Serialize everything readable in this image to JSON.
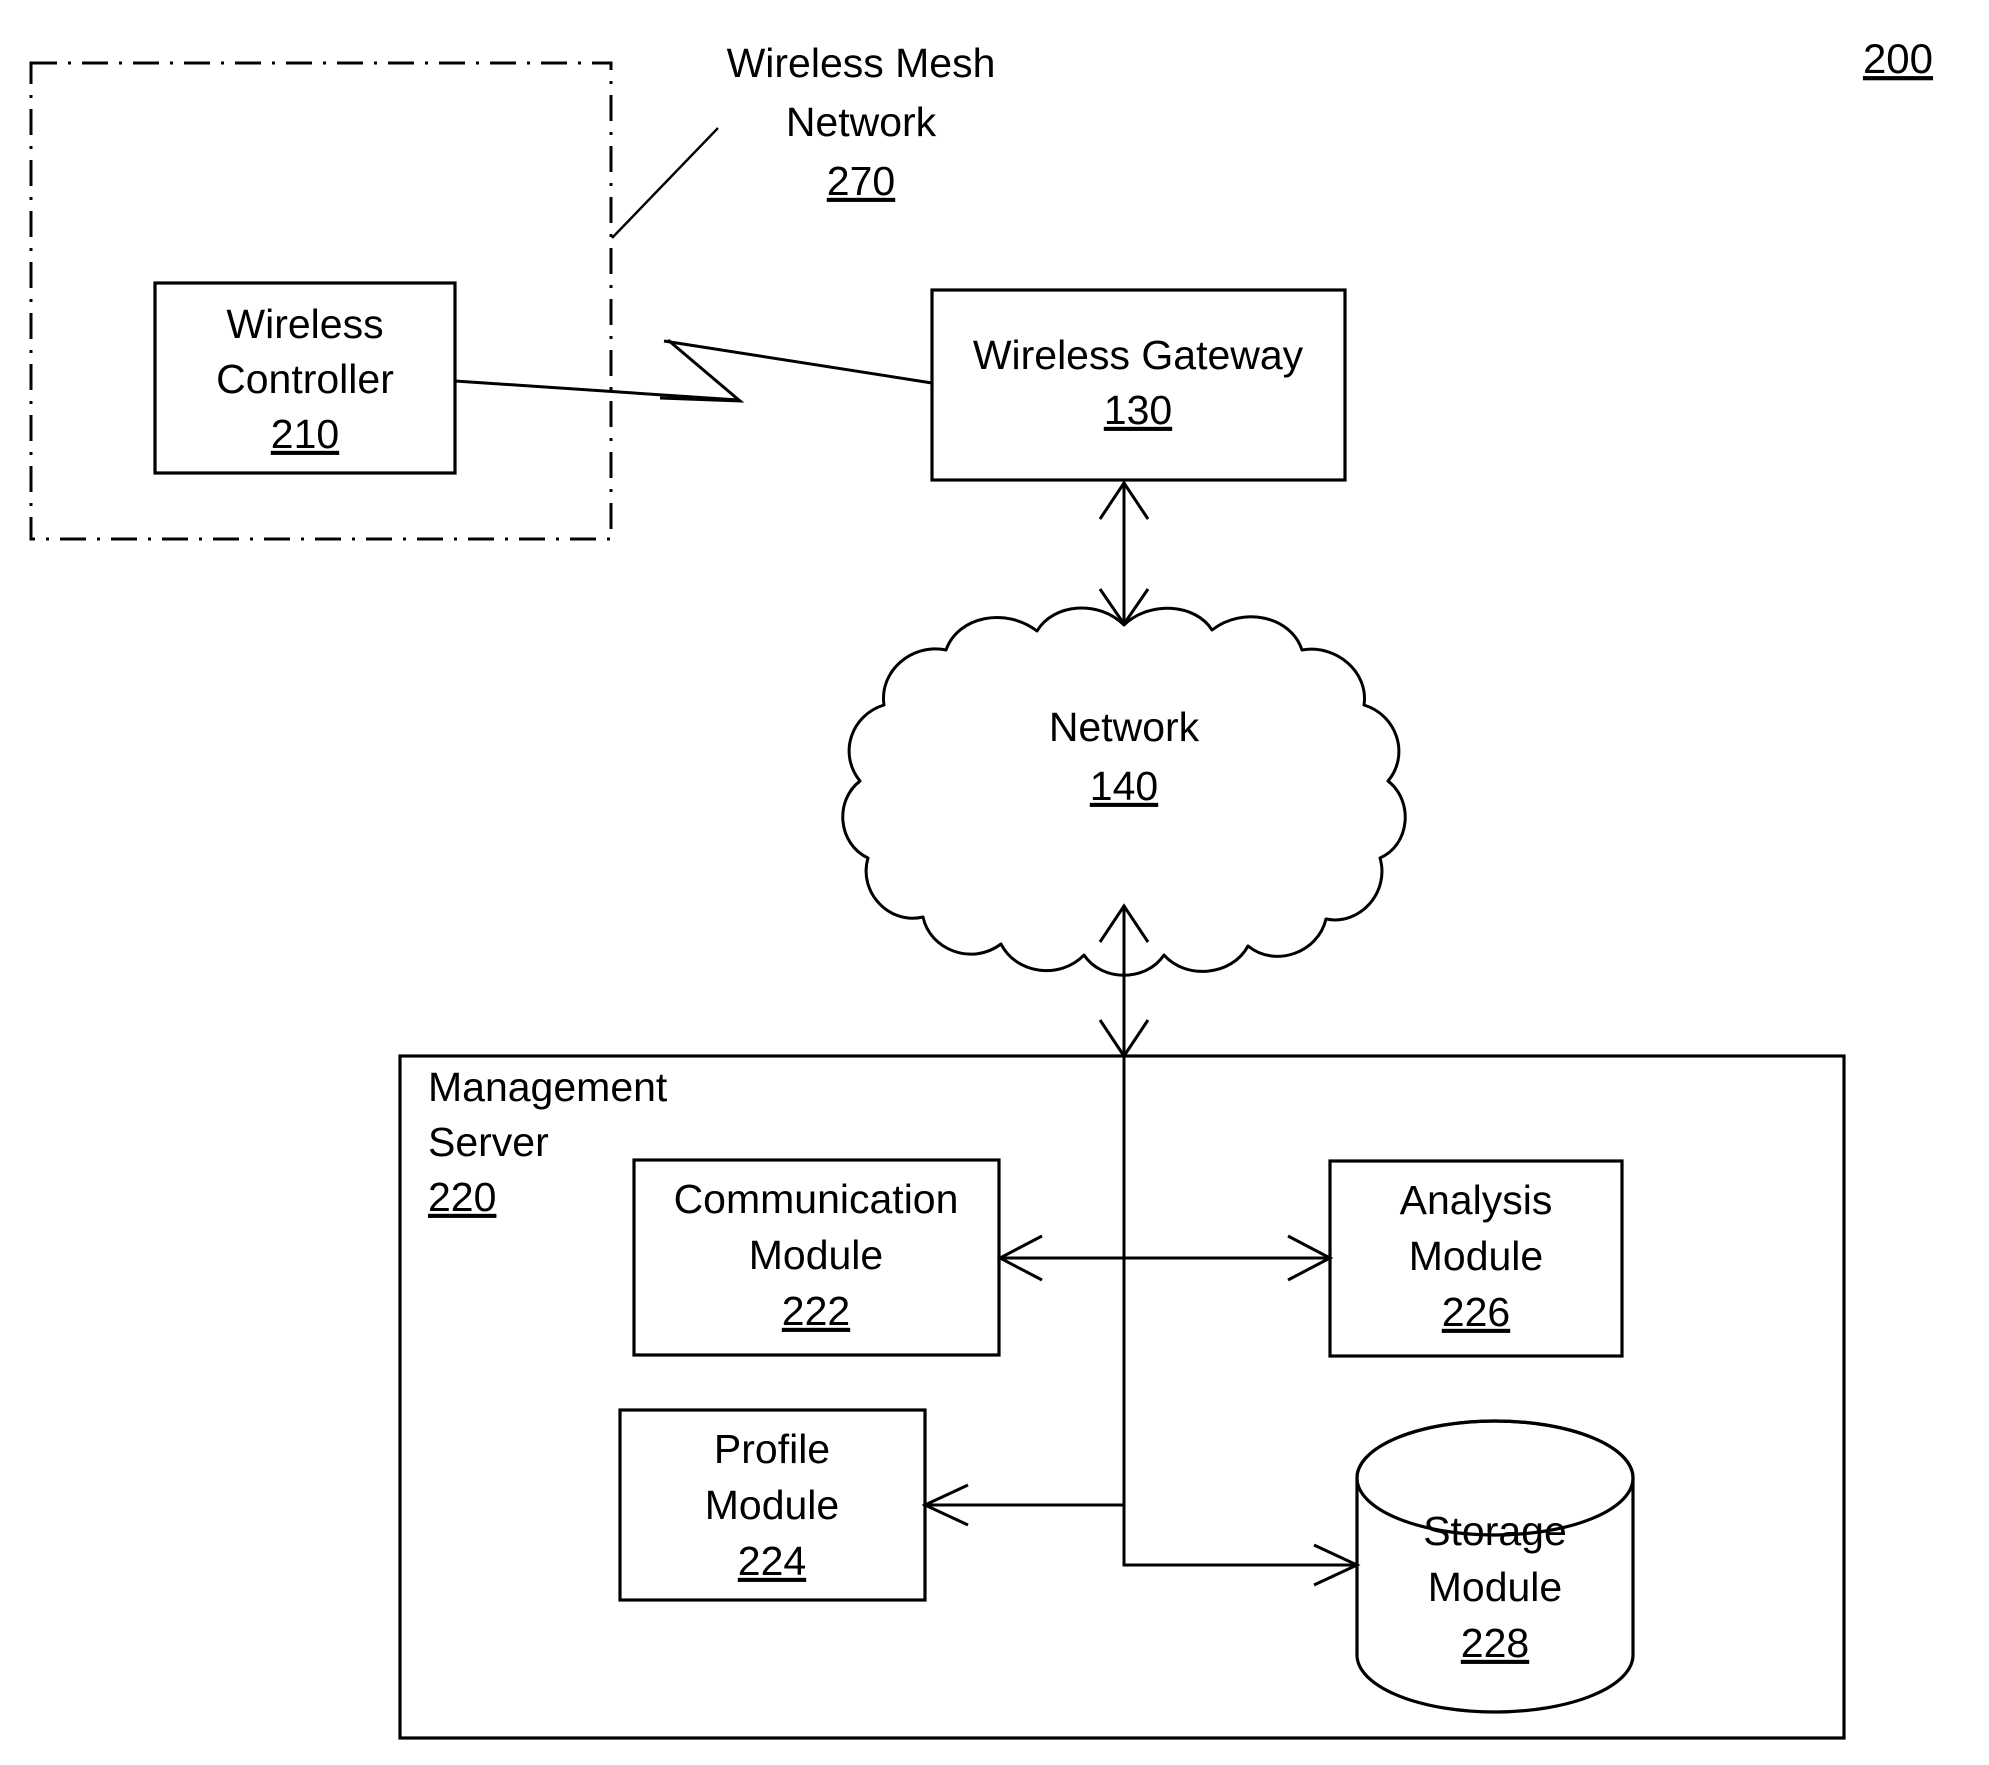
{
  "figure": {
    "number": "200"
  },
  "mesh_network": {
    "label_line1": "Wireless Mesh",
    "label_line2": "Network",
    "ref": "270"
  },
  "nodes": {
    "wireless_controller": {
      "line1": "Wireless",
      "line2": "Controller",
      "ref": "210"
    },
    "wireless_gateway": {
      "line1": "Wireless Gateway",
      "ref": "130"
    },
    "network_cloud": {
      "line1": "Network",
      "ref": "140"
    },
    "management_server": {
      "line1": "Management",
      "line2": "Server",
      "ref": "220"
    },
    "communication_module": {
      "line1": "Communication",
      "line2": "Module",
      "ref": "222"
    },
    "analysis_module": {
      "line1": "Analysis",
      "line2": "Module",
      "ref": "226"
    },
    "profile_module": {
      "line1": "Profile",
      "line2": "Module",
      "ref": "224"
    },
    "storage_module": {
      "line1": "Storage",
      "line2": "Module",
      "ref": "228"
    }
  },
  "connections": [
    {
      "name": "controller-to-gateway",
      "from": "wireless_controller",
      "to": "wireless_gateway",
      "style": "double-arrow"
    },
    {
      "name": "gateway-to-network",
      "from": "wireless_gateway",
      "to": "network_cloud",
      "style": "double-arrow"
    },
    {
      "name": "network-to-management-server",
      "from": "network_cloud",
      "to": "management_server",
      "style": "double-arrow"
    },
    {
      "name": "communication-to-analysis",
      "from": "communication_module",
      "to": "analysis_module",
      "style": "double-arrow"
    },
    {
      "name": "bus-to-profile",
      "from": "management_server_bus",
      "to": "profile_module",
      "style": "single-arrow"
    },
    {
      "name": "bus-to-storage",
      "from": "management_server_bus",
      "to": "storage_module",
      "style": "single-arrow"
    }
  ],
  "colors": {
    "stroke": "#000000",
    "background": "#ffffff"
  }
}
